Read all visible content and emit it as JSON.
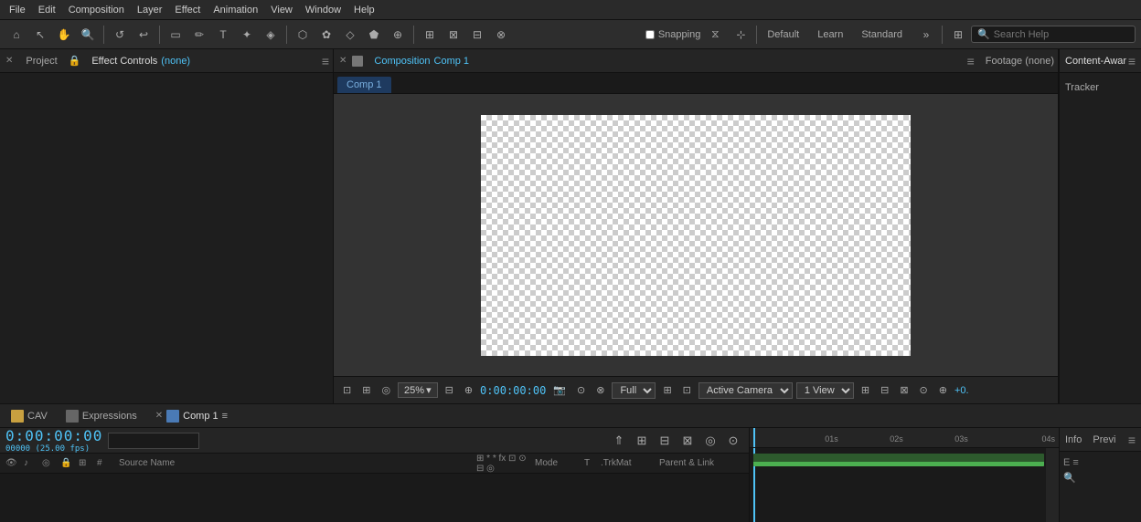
{
  "menu": {
    "items": [
      "File",
      "Edit",
      "Composition",
      "Layer",
      "Effect",
      "Animation",
      "View",
      "Window",
      "Help"
    ]
  },
  "toolbar": {
    "snapping_label": "Snapping",
    "workspace_default": "Default",
    "workspace_learn": "Learn",
    "workspace_standard": "Standard",
    "search_placeholder": "Search Help"
  },
  "left_panel": {
    "project_tab": "Project",
    "effect_controls_tab": "Effect Controls",
    "effect_controls_value": "(none)"
  },
  "comp_panel": {
    "tabs": [
      {
        "label": "Composition Comp 1"
      }
    ],
    "footage_tab": "Footage (none)",
    "subtab": "Comp 1",
    "zoom": "25%",
    "timecode": "0:00:00:00",
    "quality": "Full",
    "camera": "Active Camera",
    "views": "1 View"
  },
  "right_panel": {
    "tabs": [
      "Content-Awar",
      "Tracker"
    ]
  },
  "timeline": {
    "tabs": [
      {
        "label": "CAV"
      },
      {
        "label": "Expressions"
      },
      {
        "label": "Comp 1"
      }
    ],
    "timecode": "0:00:00:00",
    "fps": "00000 (25.00 fps)",
    "columns": {
      "source_name": "Source Name",
      "mode": "Mode",
      "t": "T",
      "trk_mat": ".TrkMat",
      "parent_link": "Parent & Link"
    },
    "ruler_marks": [
      "",
      "01s",
      "02s",
      "03s",
      "04s"
    ],
    "info_tab": "Info",
    "preview_tab": "Previ",
    "bottom_tabs": [
      "E ≡",
      "🔍"
    ]
  }
}
